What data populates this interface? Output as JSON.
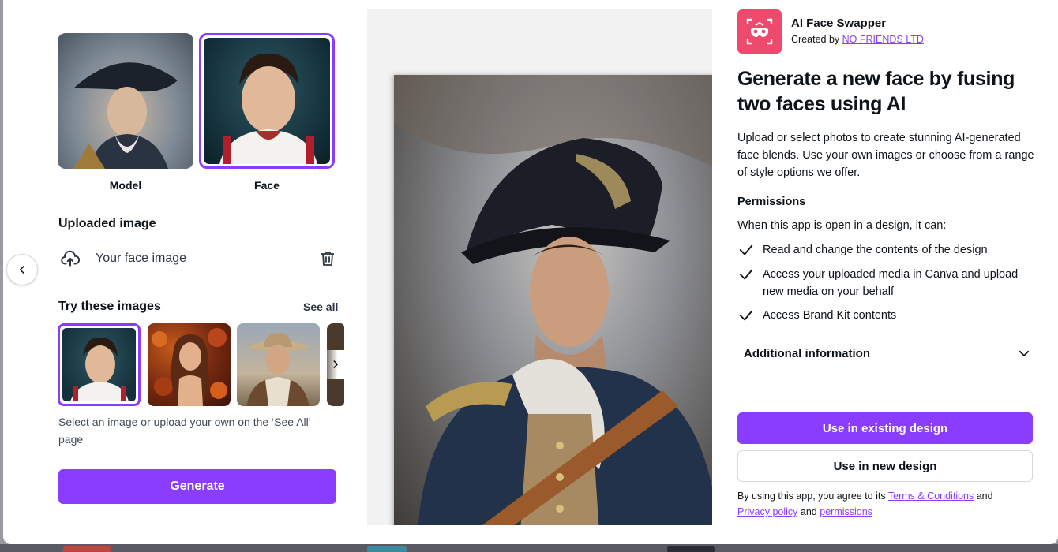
{
  "left_panel": {
    "model_label": "Model",
    "face_label": "Face",
    "uploaded_title": "Uploaded image",
    "uploaded_item_label": "Your face image",
    "try_title": "Try these images",
    "see_all": "See all",
    "hint": "Select an image or upload your own on the ‘See All’ page",
    "generate_label": "Generate"
  },
  "app": {
    "name": "AI Face Swapper",
    "created_by_prefix": "Created by",
    "creator": "NO FRIENDS LTD",
    "headline": "Generate a new face by fusing two faces using AI",
    "description": "Upload or select photos to create stunning AI-generated face blends. Use your own images or choose from a range of style options we offer.",
    "permissions_title": "Permissions",
    "permissions_intro": "When this app is open in a design, it can:",
    "permissions": [
      "Read and change the contents of the design",
      "Access your uploaded media in Canva and upload new media on your behalf",
      "Access Brand Kit contents"
    ],
    "additional_info": "Additional information",
    "use_existing": "Use in existing design",
    "use_new": "Use in new design",
    "terms_prefix": "By using this app, you agree to its",
    "terms_link": "Terms & Conditions",
    "terms_and": "and",
    "privacy_link": "Privacy policy",
    "terms_and2": "and",
    "permissions_link": "permissions"
  },
  "colors": {
    "accent": "#8b3dff",
    "app_icon_bg": "#ee4a6c"
  },
  "icons": [
    "chevron-left-icon",
    "upload-cloud-icon",
    "trash-icon",
    "chevron-right-icon",
    "check-icon",
    "chevron-down-icon",
    "mask-icon"
  ]
}
